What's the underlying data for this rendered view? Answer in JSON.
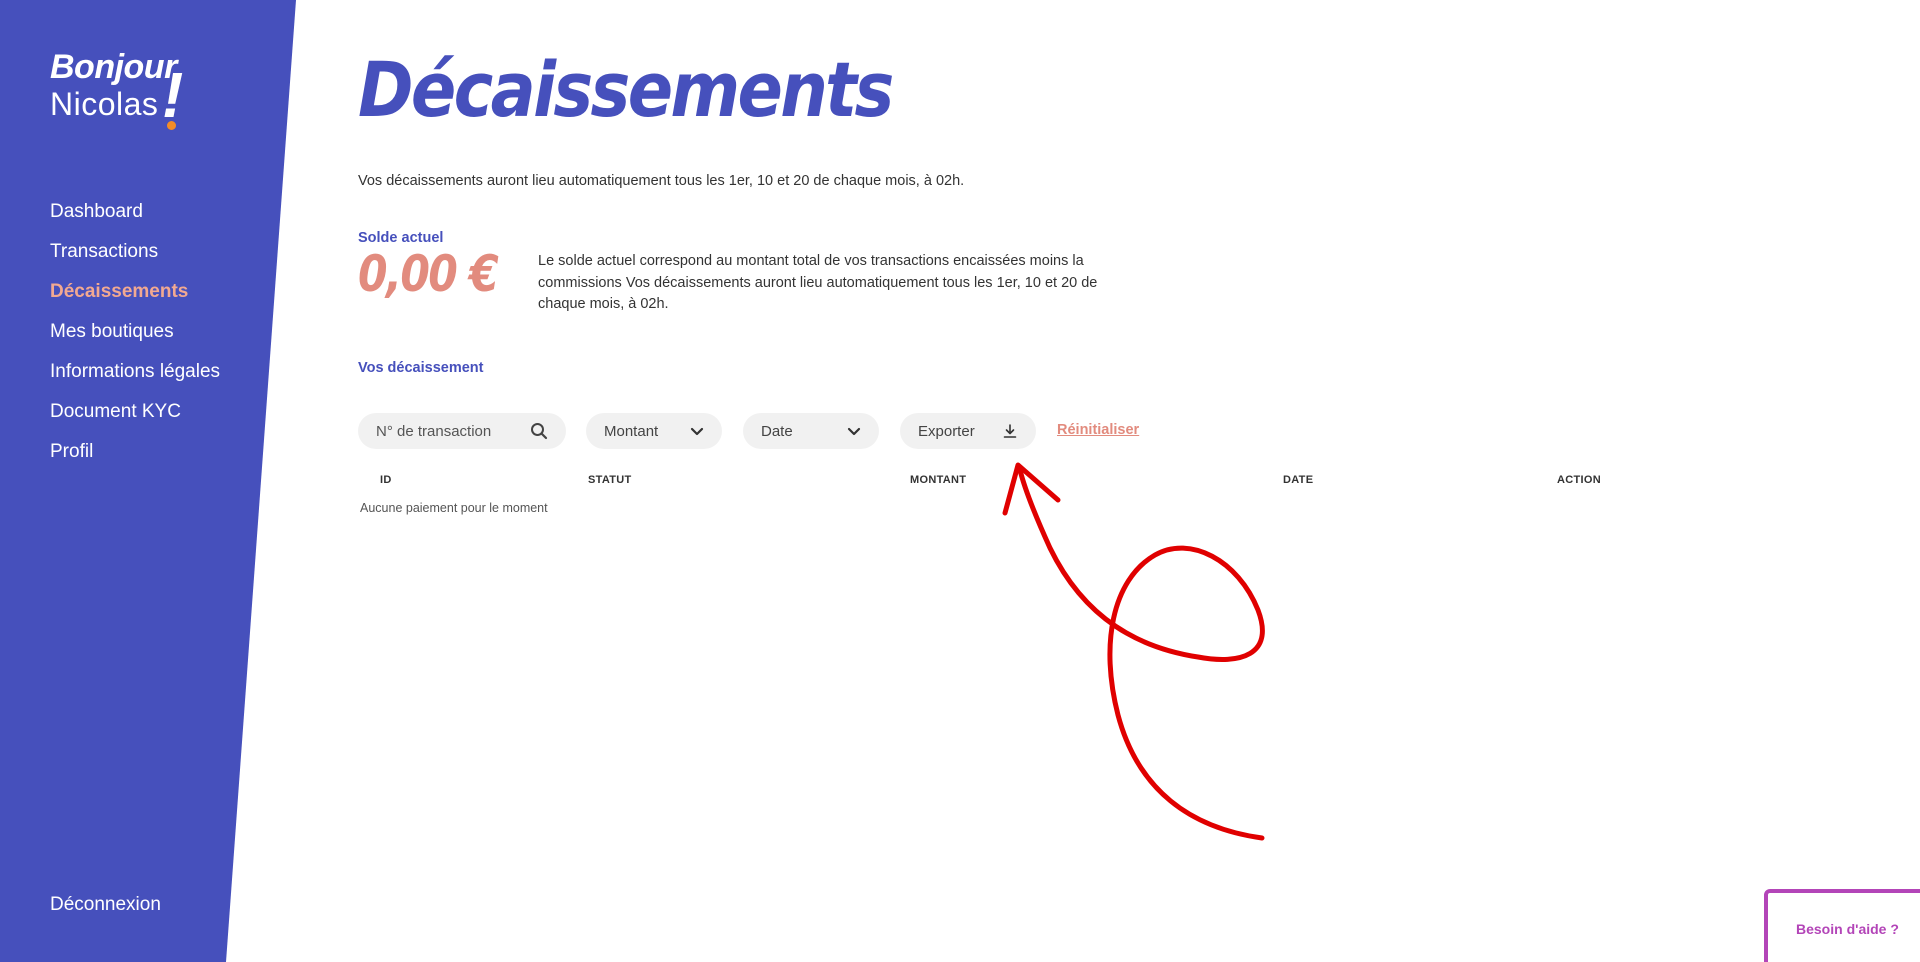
{
  "colors": {
    "brand": "#4650bc",
    "accent": "#e28b7e",
    "active_nav": "#f2a991",
    "orange": "#f28c28",
    "annotation": "#e00000",
    "help": "#b345b8"
  },
  "sidebar": {
    "greeting_hello": "Bonjour",
    "greeting_name": "Nicolas",
    "greeting_bang": "!",
    "items": [
      {
        "label": "Dashboard"
      },
      {
        "label": "Transactions"
      },
      {
        "label": "Décaissements",
        "active": true
      },
      {
        "label": "Mes boutiques"
      },
      {
        "label": "Informations légales"
      },
      {
        "label": "Document KYC"
      },
      {
        "label": "Profil"
      }
    ],
    "logout_label": "Déconnexion"
  },
  "main": {
    "title": "Décaissements",
    "intro": "Vos décaissements auront lieu automatiquement tous les 1er, 10 et 20 de chaque mois, à 02h.",
    "balance": {
      "label": "Solde actuel",
      "value": "0,00 €",
      "description": "Le solde actuel correspond au montant total de vos transactions encaissées moins la commissions Vos décaissements auront lieu automatiquement tous les 1er, 10 et 20 de chaque mois, à 02h."
    },
    "section_title": "Vos décaissement",
    "filters": {
      "search_placeholder": "N° de transaction",
      "search_icon": "search-icon",
      "amount_label": "Montant",
      "date_label": "Date",
      "export_label": "Exporter",
      "export_icon": "download-icon",
      "reset_label": "Réinitialiser"
    },
    "table": {
      "columns": [
        "ID",
        "STATUT",
        "MONTANT",
        "DATE",
        "ACTION"
      ],
      "rows": [],
      "empty_message": "Aucune paiement pour le moment"
    }
  },
  "help": {
    "label": "Besoin d'aide ?"
  }
}
